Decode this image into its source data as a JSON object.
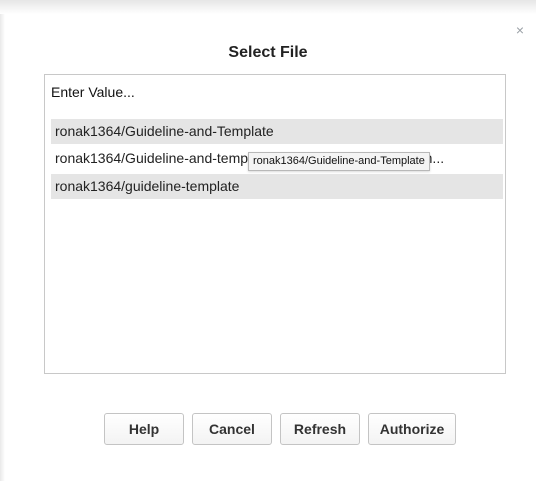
{
  "dialog": {
    "title": "Select File",
    "close_glyph": "×"
  },
  "list": {
    "placeholder": "Enter Value...",
    "items": [
      {
        "label": "ronak1364/Guideline-and-Template"
      },
      {
        "label": "ronak1364/Guideline-and-template-for-documentation-and-m..."
      },
      {
        "label": "ronak1364/guideline-template"
      }
    ]
  },
  "tooltip": {
    "text": "ronak1364/Guideline-and-Template"
  },
  "buttons": {
    "help": "Help",
    "cancel": "Cancel",
    "refresh": "Refresh",
    "authorize": "Authorize"
  }
}
